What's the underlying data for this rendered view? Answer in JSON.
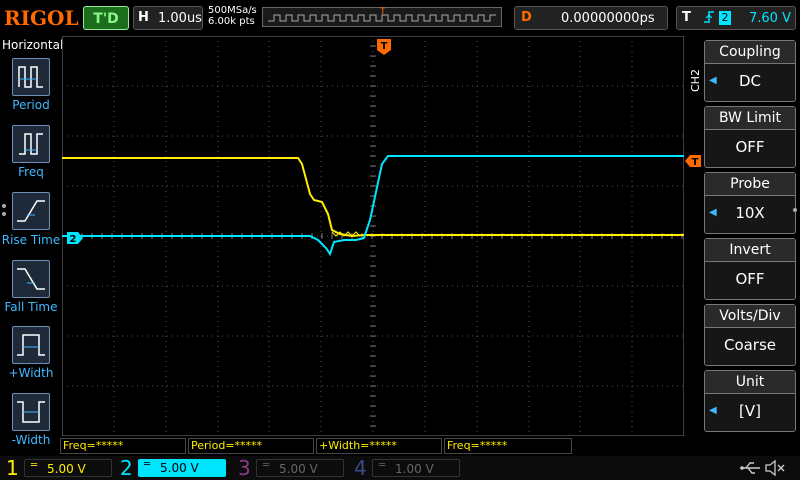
{
  "header": {
    "logo": "RIGOL",
    "run_status": "T'D",
    "timebase_label": "H",
    "timebase_value": "1.00us",
    "sample_rate": "500MSa/s",
    "memory_depth": "6.00k pts",
    "hpos_marker": "T",
    "delay_label": "D",
    "delay_value": "0.00000000ps",
    "trigger_label": "T",
    "trigger_edge": "rising-edge-icon",
    "trigger_source": "2",
    "trigger_level": "7.60 V"
  },
  "left_panel": {
    "title": "Horizontal",
    "items": [
      {
        "label": "Period",
        "icon": "period-icon"
      },
      {
        "label": "Freq",
        "icon": "frequency-icon"
      },
      {
        "label": "Rise Time",
        "icon": "rise-time-icon"
      },
      {
        "label": "Fall Time",
        "icon": "fall-time-icon"
      },
      {
        "label": "+Width",
        "icon": "positive-width-icon"
      },
      {
        "label": "-Width",
        "icon": "negative-width-icon"
      }
    ]
  },
  "right_panel": {
    "channel_tag": "CH2",
    "items": [
      {
        "header": "Coupling",
        "value": "DC"
      },
      {
        "header": "BW Limit",
        "value": "OFF"
      },
      {
        "header": "Probe",
        "value": "10X"
      },
      {
        "header": "Invert",
        "value": "OFF"
      },
      {
        "header": "Volts/Div",
        "value": "Coarse"
      },
      {
        "header": "Unit",
        "value": "[V]"
      }
    ]
  },
  "markers": {
    "trigger_position": "T",
    "ch2_marker": "2",
    "trigger_level_marker": "T"
  },
  "measurements": [
    {
      "text": "Freq=*****"
    },
    {
      "text": "Period=*****"
    },
    {
      "text": "+Width=*****"
    },
    {
      "text": "Freq=*****"
    }
  ],
  "channels": [
    {
      "num": "1",
      "scale": "5.00 V",
      "color": "#ffee00",
      "active": false
    },
    {
      "num": "2",
      "scale": "5.00 V",
      "color": "#00e5ff",
      "active": true
    },
    {
      "num": "3",
      "scale": "5.00 V",
      "color": "#8a3a8a",
      "active": false
    },
    {
      "num": "4",
      "scale": "1.00 V",
      "color": "#3a4a8a",
      "active": false
    }
  ],
  "status_icons": [
    "usb-icon",
    "speaker-muted-icon"
  ],
  "colors": {
    "ch1": "#ffee00",
    "ch2": "#00e5ff",
    "accent": "#ff6a00",
    "menu": "#40b8ff"
  }
}
